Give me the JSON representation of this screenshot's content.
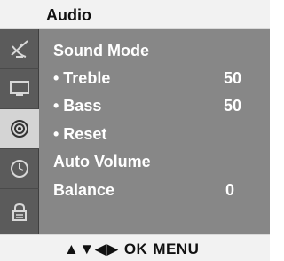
{
  "menu": {
    "title": "Audio"
  },
  "sidebar": {
    "tabs": [
      {
        "icon": "satellite-dish-icon",
        "active": false
      },
      {
        "icon": "monitor-icon",
        "active": false
      },
      {
        "icon": "speaker-icon",
        "active": true
      },
      {
        "icon": "clock-icon",
        "active": false
      },
      {
        "icon": "lock-icon",
        "active": false
      }
    ]
  },
  "items": {
    "sound_mode": {
      "label": "Sound Mode"
    },
    "treble": {
      "label": "• Treble",
      "value": "50"
    },
    "bass": {
      "label": "• Bass",
      "value": "50"
    },
    "reset": {
      "label": "• Reset"
    },
    "auto_volume": {
      "label": "Auto Volume"
    },
    "balance": {
      "label": "Balance",
      "value": "0"
    }
  },
  "footer": {
    "arrows": "▲▼◀▶",
    "ok": "OK",
    "menu": "MENU"
  },
  "colors": {
    "panel": "#878787",
    "sidebar": "#5b5b5b",
    "active_tab": "#d4d4d4",
    "bars": "#f2f2f2",
    "text_on_panel": "#ffffff"
  }
}
